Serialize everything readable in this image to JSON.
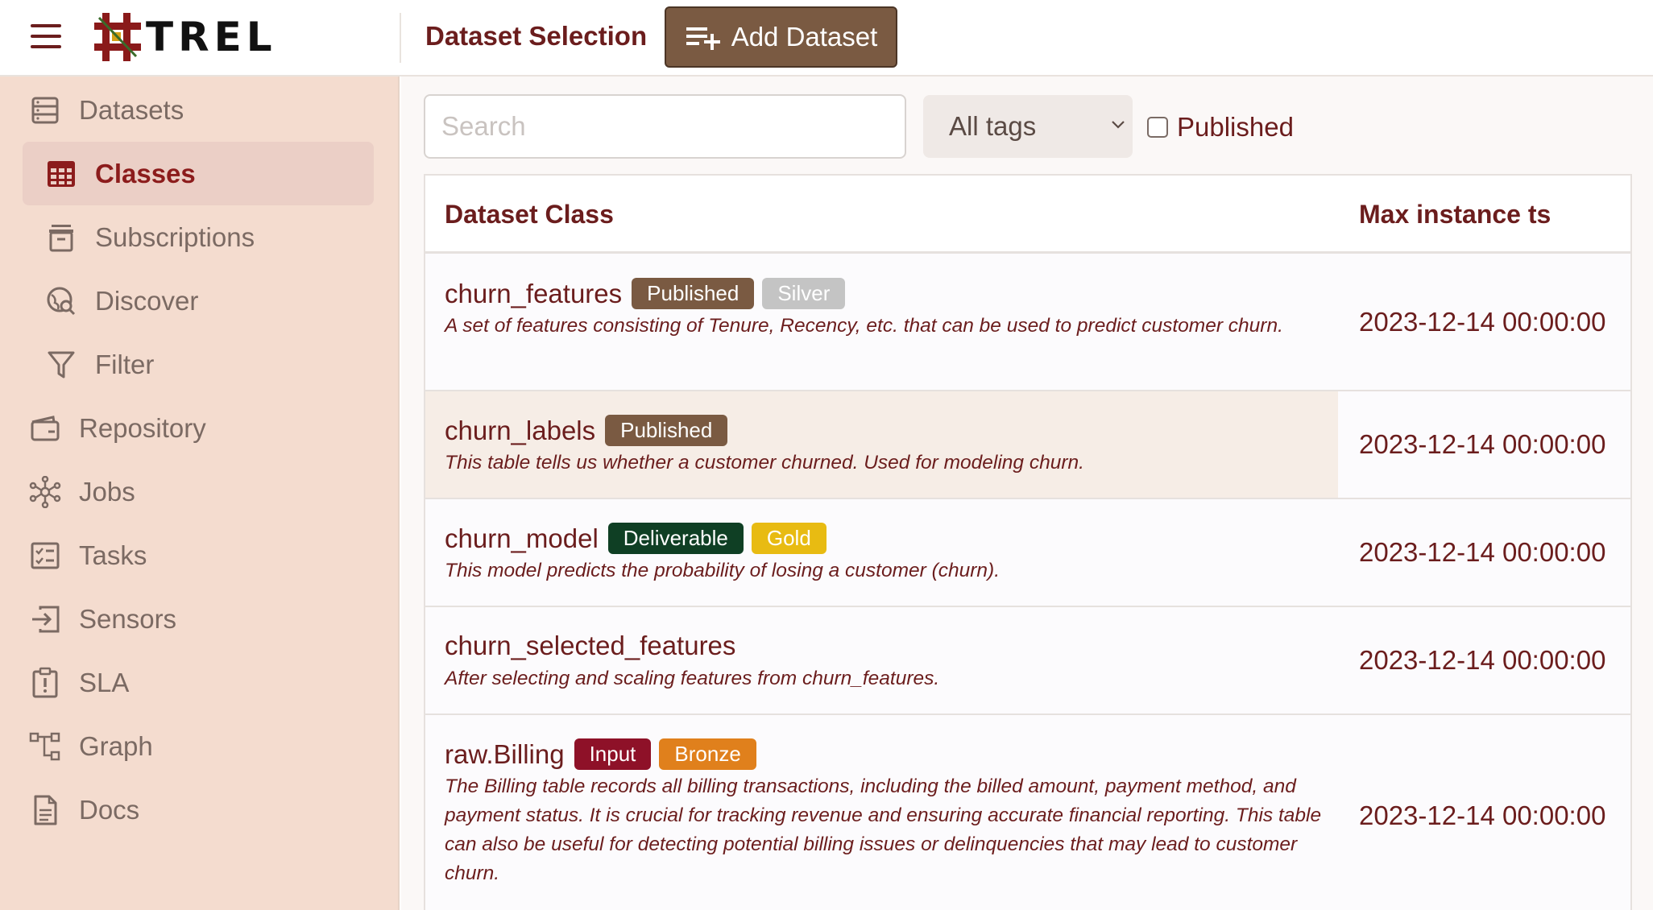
{
  "app": {
    "logo_text": "TREL"
  },
  "header": {
    "page_title": "Dataset Selection",
    "add_button_label": "Add Dataset"
  },
  "sidebar": {
    "items": [
      {
        "label": "Datasets",
        "icon": "datasets-icon",
        "active": false
      },
      {
        "label": "Classes",
        "icon": "table-grid-icon",
        "active": true
      },
      {
        "label": "Subscriptions",
        "icon": "inbox-icon",
        "active": false
      },
      {
        "label": "Discover",
        "icon": "globe-search-icon",
        "active": false
      },
      {
        "label": "Filter",
        "icon": "filter-icon",
        "active": false
      },
      {
        "label": "Repository",
        "icon": "wallet-icon",
        "active": false
      },
      {
        "label": "Jobs",
        "icon": "network-icon",
        "active": false
      },
      {
        "label": "Tasks",
        "icon": "checklist-icon",
        "active": false
      },
      {
        "label": "Sensors",
        "icon": "enter-icon",
        "active": false
      },
      {
        "label": "SLA",
        "icon": "alert-clipboard-icon",
        "active": false
      },
      {
        "label": "Graph",
        "icon": "hierarchy-icon",
        "active": false
      },
      {
        "label": "Docs",
        "icon": "document-icon",
        "active": false
      }
    ]
  },
  "filters": {
    "search_placeholder": "Search",
    "tags_selected": "All tags",
    "published_label": "Published",
    "published_checked": false
  },
  "table": {
    "columns": [
      "Dataset Class",
      "Max instance ts"
    ],
    "rows": [
      {
        "name": "churn_features",
        "badges": [
          {
            "text": "Published",
            "color": "#7a5a42"
          },
          {
            "text": "Silver",
            "color": "#c4c4c4"
          }
        ],
        "description": "A set of features consisting of Tenure, Recency, etc. that can be used to predict customer churn.",
        "ts": "2023-12-14 00:00:00"
      },
      {
        "name": "churn_labels",
        "badges": [
          {
            "text": "Published",
            "color": "#7a5a42"
          }
        ],
        "description": "This table tells us whether a customer churned. Used for modeling churn.",
        "ts": "2023-12-14 00:00:00",
        "highlighted": true
      },
      {
        "name": "churn_model",
        "badges": [
          {
            "text": "Deliverable",
            "color": "#0f3f24"
          },
          {
            "text": "Gold",
            "color": "#e8bb12"
          }
        ],
        "description": "This model predicts the probability of losing a customer (churn).",
        "ts": "2023-12-14 00:00:00"
      },
      {
        "name": "churn_selected_features",
        "badges": [],
        "description": "After selecting and scaling features from churn_features.",
        "ts": "2023-12-14 00:00:00"
      },
      {
        "name": "raw.Billing",
        "badges": [
          {
            "text": "Input",
            "color": "#8e1128"
          },
          {
            "text": "Bronze",
            "color": "#e0801c"
          }
        ],
        "description": "The Billing table records all billing transactions, including the billed amount, payment method, and payment status. It is crucial for tracking revenue and ensuring accurate financial reporting. This table can also be useful for detecting potential billing issues or delinquencies that may lead to customer churn.",
        "ts": "2023-12-14 00:00:00"
      }
    ]
  },
  "colors": {
    "accent": "#6b1d1d",
    "sidebar_bg": "#f4dccf",
    "button_bg": "#7a5a42"
  }
}
